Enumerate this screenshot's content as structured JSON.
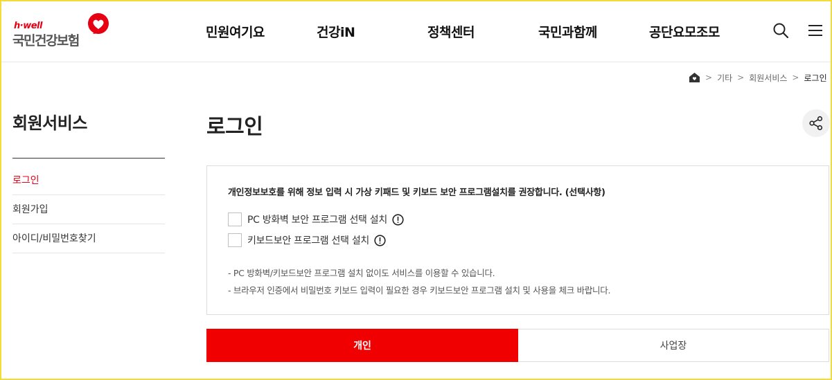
{
  "header": {
    "logo_tagline": "h·well",
    "logo_name": "국민건강보험",
    "nav": [
      {
        "label": "민원여기요"
      },
      {
        "label": "건강iN"
      },
      {
        "label": "정책센터"
      },
      {
        "label": "국민과함께"
      },
      {
        "label": "공단요모조모"
      }
    ],
    "search_icon": "search-icon",
    "menu_icon": "hamburger-icon"
  },
  "breadcrumb": {
    "home_icon": "home-icon",
    "items": [
      {
        "label": "기타"
      },
      {
        "label": "회원서비스"
      },
      {
        "label": "로그인"
      }
    ]
  },
  "lnb": {
    "title": "회원서비스",
    "items": [
      {
        "label": "로그인",
        "active": true
      },
      {
        "label": "회원가입",
        "active": false
      },
      {
        "label": "아이디/비밀번호찾기",
        "active": false
      }
    ]
  },
  "main": {
    "title": "로그인",
    "share_icon": "share-icon",
    "notice": {
      "title": "개인정보보호를 위해 정보 입력 시 가상 키패드 및 키보드 보안 프로그램설치를 권장합니다. (선택사항)",
      "options": [
        {
          "label": "PC 방화벽 보안 프로그램 선택 설치",
          "checked": false
        },
        {
          "label": "키보드보안 프로그램 선택 설치",
          "checked": false
        }
      ],
      "notes": [
        "-  PC 방화벽/키보드보안 프로그램 설치 없이도 서비스를 이용할 수 있습니다.",
        "-  브라우저 인증에서 비밀번호 키보드 입력이 필요한 경우 키보드보안 프로그램 설치 및 사용을 체크 바랍니다."
      ]
    },
    "tabs": [
      {
        "label": "개인",
        "active": true
      },
      {
        "label": "사업장",
        "active": false
      }
    ]
  },
  "colors": {
    "brand_red": "#e60012",
    "tab_active": "#f00000"
  }
}
